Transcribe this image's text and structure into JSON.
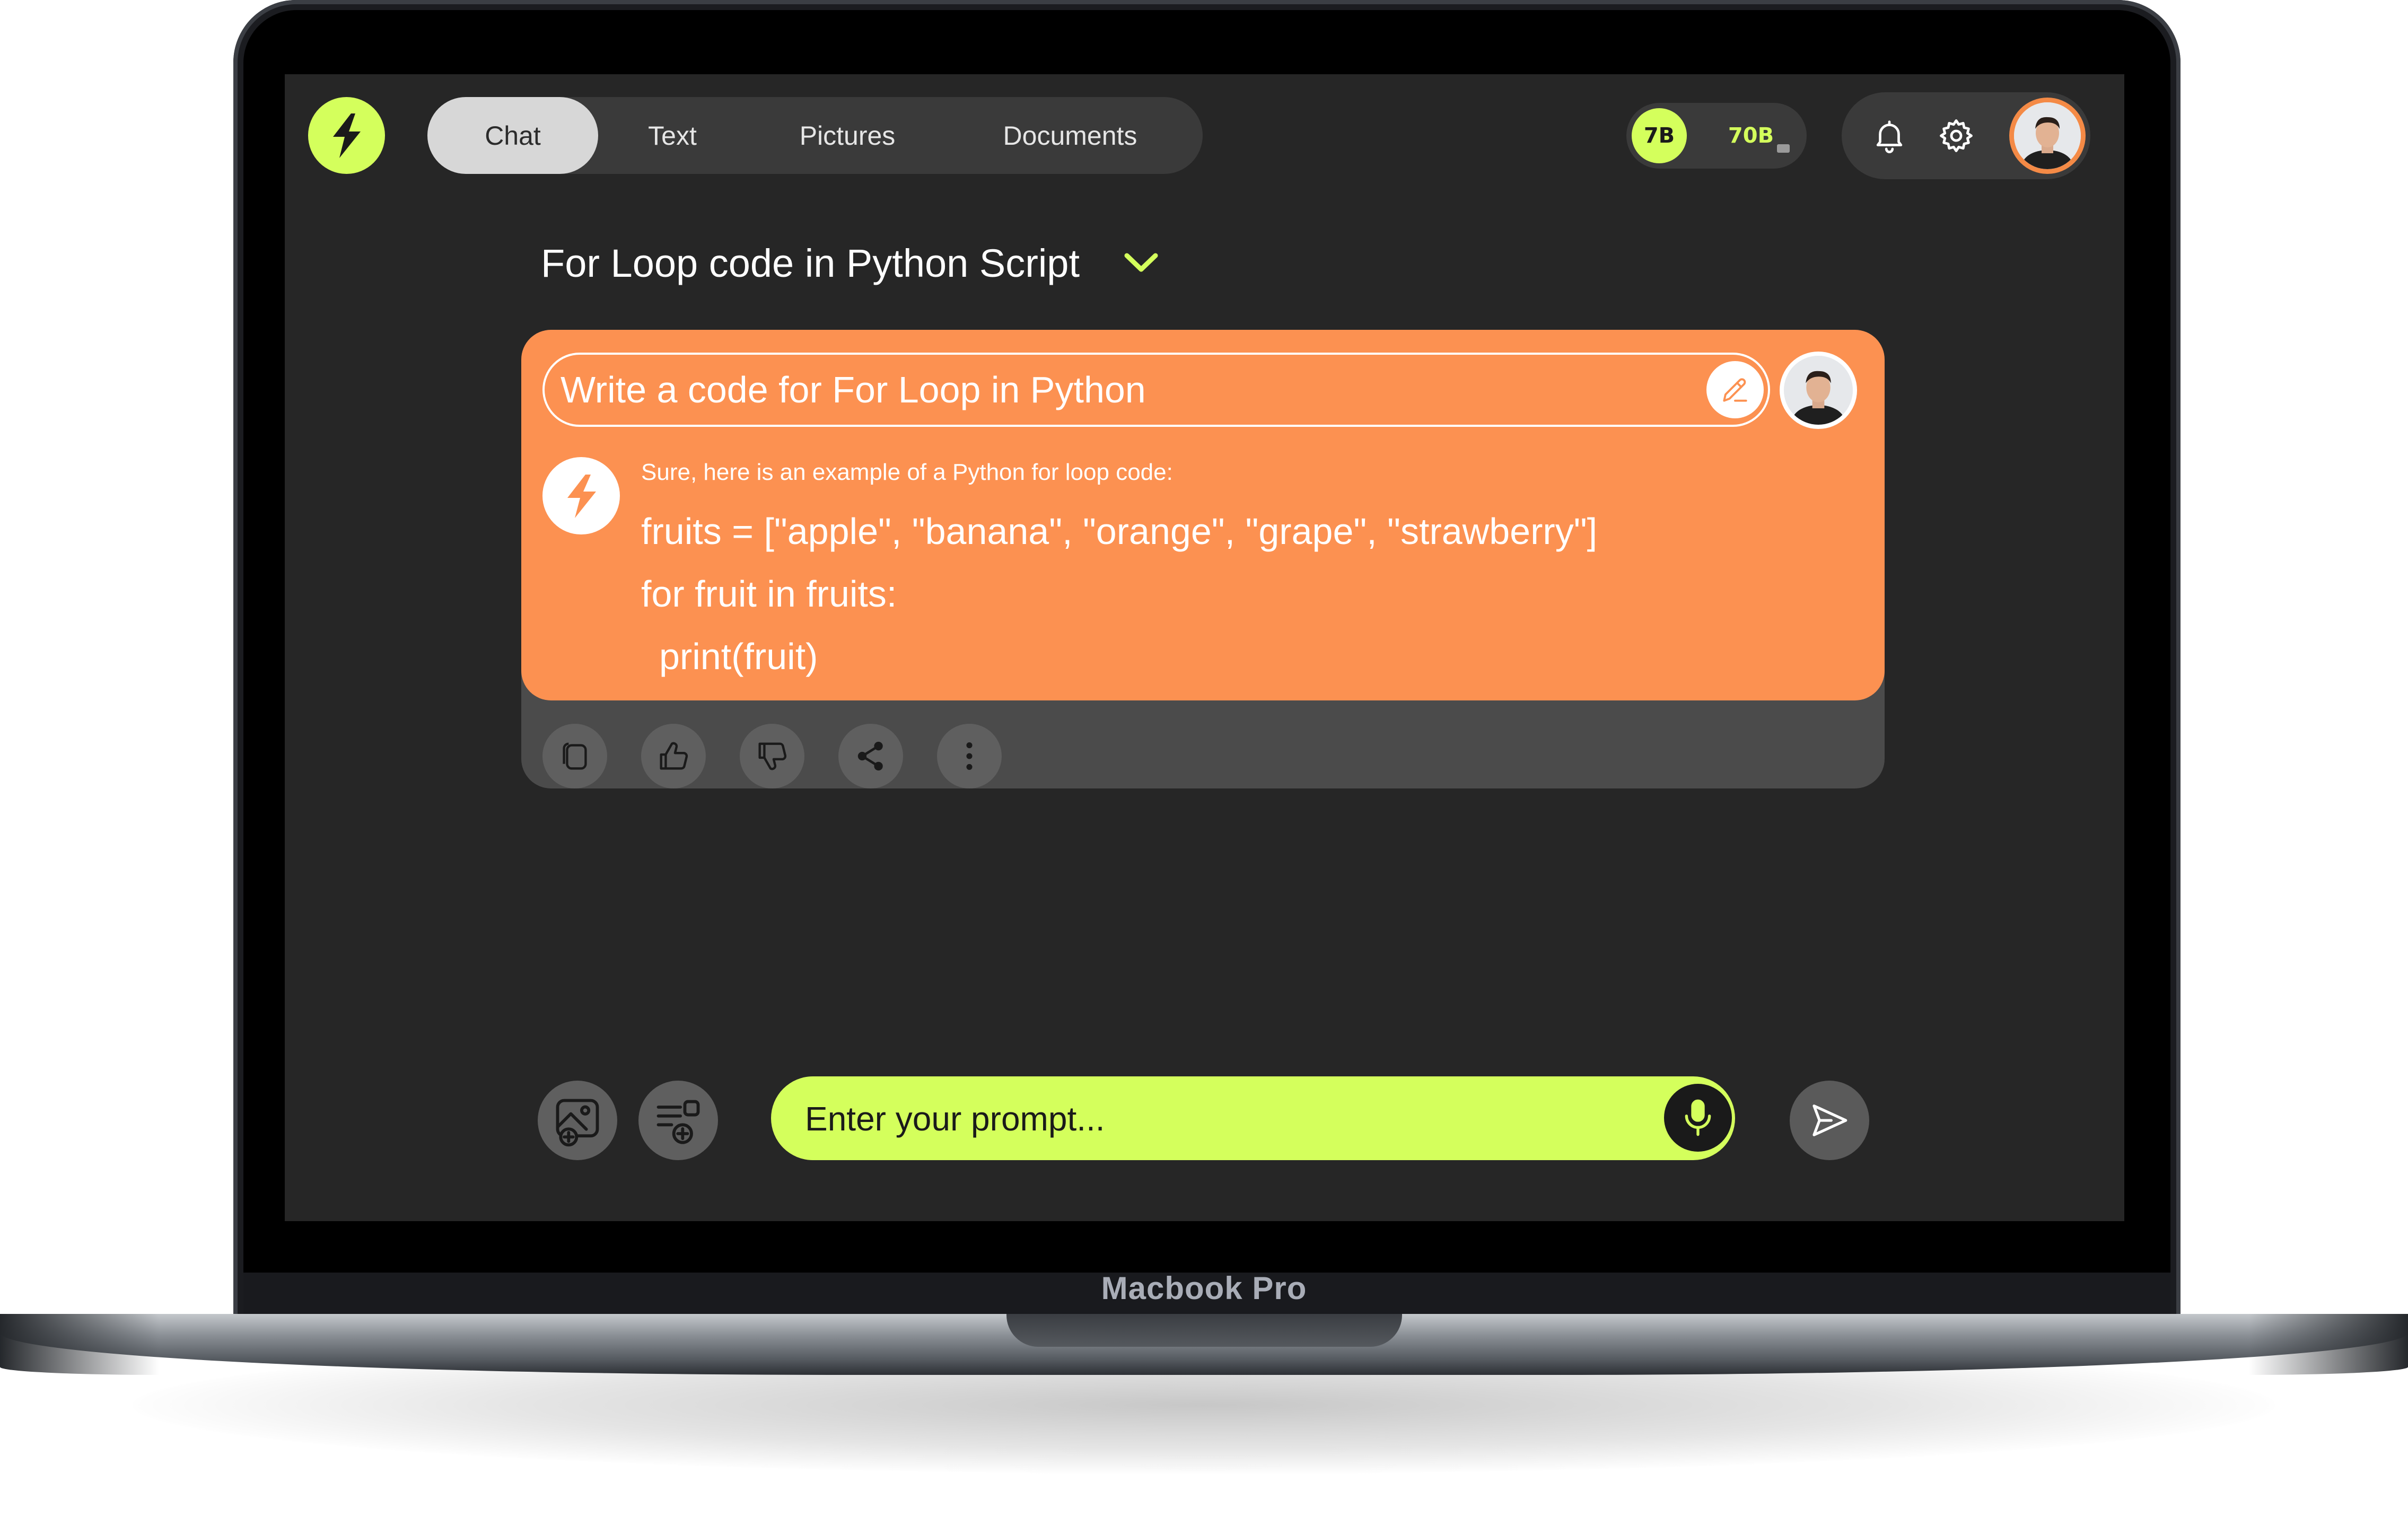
{
  "device": {
    "label": "Macbook Pro"
  },
  "header": {
    "logo_icon": "lightning-bolt-icon",
    "tabs": [
      {
        "label": "Chat",
        "active": true
      },
      {
        "label": "Text",
        "active": false
      },
      {
        "label": "Pictures",
        "active": false
      },
      {
        "label": "Documents",
        "active": false
      }
    ],
    "models": {
      "small": "7B",
      "large": "70B",
      "selected": "7B"
    },
    "icons": [
      "bell-icon",
      "gear-icon",
      "avatar"
    ]
  },
  "conversation": {
    "title": "For Loop code in Python Script",
    "prompt": "Write a code for For Loop in Python",
    "answer_intro": "Sure, here is an example of a Python for loop code:",
    "code": {
      "line1": "fruits = [\"apple\", \"banana\", \"orange\", \"grape\", \"strawberry\"]",
      "line2": "for fruit in fruits:",
      "line3": "print(fruit)"
    },
    "actions": [
      "copy-icon",
      "thumbs-up-icon",
      "thumbs-down-icon",
      "share-icon",
      "more-options-icon"
    ]
  },
  "composer": {
    "placeholder": "Enter your prompt...",
    "icons": [
      "add-image-icon",
      "add-document-icon",
      "microphone-icon",
      "send-icon"
    ]
  },
  "colors": {
    "accent": "#d4ff5c",
    "card": "#fc9151",
    "background": "#262626",
    "avatar_ring": "#f48a46"
  }
}
